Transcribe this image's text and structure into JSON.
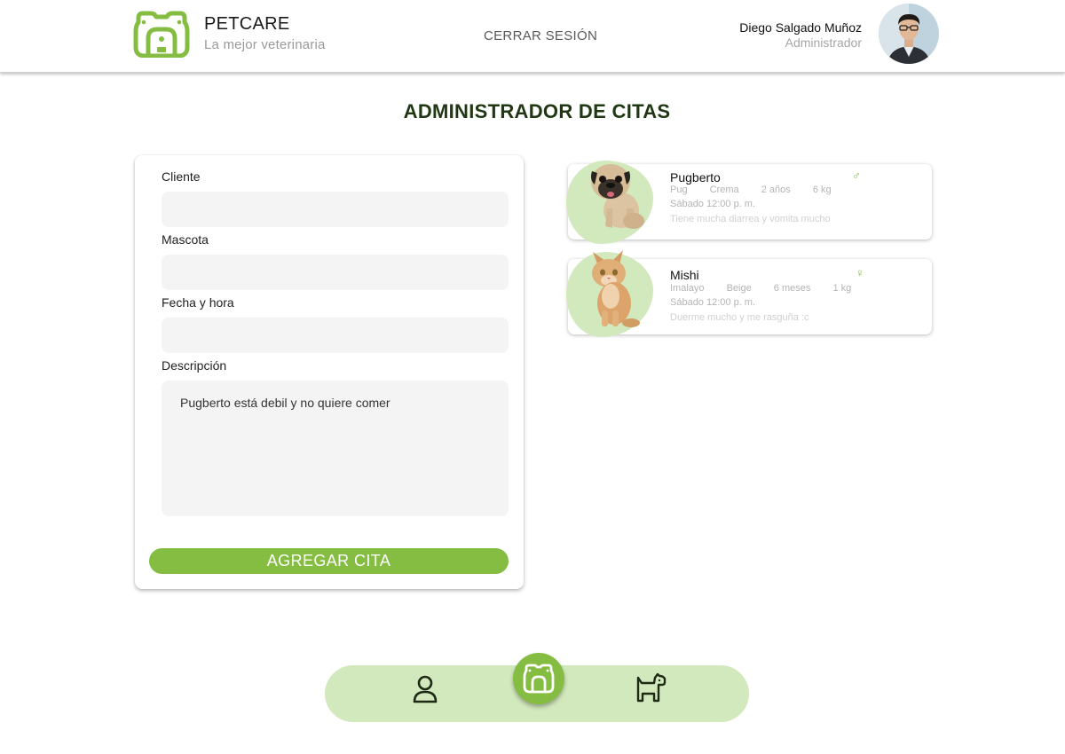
{
  "header": {
    "brand_title": "PETCARE",
    "brand_subtitle": "La mejor veterinaria",
    "logout_label": "CERRAR SESIÓN",
    "user_name": "Diego Salgado Muñoz",
    "user_role": "Administrador"
  },
  "page_title": "ADMINISTRADOR DE CITAS",
  "form": {
    "fields": [
      {
        "label": "Cliente",
        "value": ""
      },
      {
        "label": "Mascota",
        "value": ""
      },
      {
        "label": "Fecha y hora",
        "value": ""
      }
    ],
    "description_label": "Descripción",
    "description_value": "Pugberto está debil y no quiere comer",
    "submit_label": "AGREGAR CITA"
  },
  "appointments": [
    {
      "name": "Pugberto",
      "breed": "Pug",
      "color": "Crema",
      "age": "2 años",
      "weight": "6 kg",
      "date": "Sábado 12:00 p. m.",
      "description": "Tiene mucha diarrea y vomita mucho",
      "gender_icon": "♂"
    },
    {
      "name": "Mishi",
      "breed": "Imalayo",
      "color": "Beige",
      "age": "6 meses",
      "weight": "1 kg",
      "date": "Sábado 12:00 p. m.",
      "description": "Duerme mucho y me rasguña :c",
      "gender_icon": "♀"
    }
  ],
  "colors": {
    "accent": "#84bd41",
    "accent_light": "#d2e8bd",
    "title": "#1f3712"
  }
}
